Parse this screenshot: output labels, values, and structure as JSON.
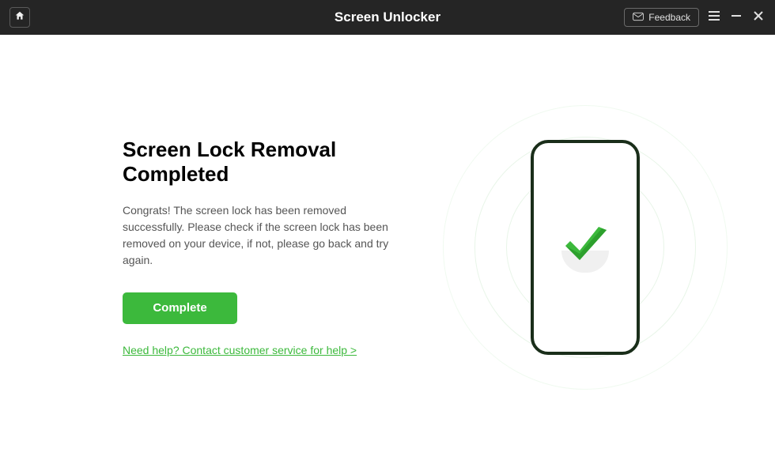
{
  "titlebar": {
    "title": "Screen Unlocker",
    "feedback_label": "Feedback"
  },
  "main": {
    "heading": "Screen Lock Removal Completed",
    "description": "Congrats! The screen lock has been removed successfully. Please check if the screen lock has been removed on your device, if not, please go back and try again.",
    "complete_button": "Complete",
    "help_link": "Need help? Contact customer service for help >"
  },
  "colors": {
    "accent": "#3cb93c",
    "titlebar_bg": "#252525"
  }
}
